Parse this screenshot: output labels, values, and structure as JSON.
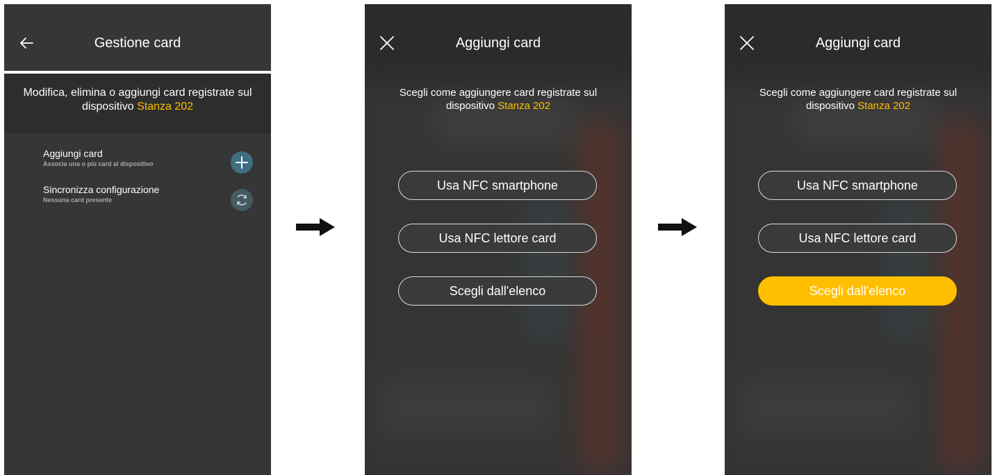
{
  "screen1": {
    "title": "Gestione card",
    "description_prefix": "Modifica, elimina o aggiungi card registrate sul dispositivo",
    "device_name": "Stanza 202",
    "items": [
      {
        "title": "Aggiungi card",
        "subtitle": "Associa una o più card al dispositivo",
        "icon": "plus-icon"
      },
      {
        "title": "Sincronizza configurazione",
        "subtitle": "Nessuna card presente",
        "icon": "sync-icon"
      }
    ]
  },
  "screen2": {
    "title": "Aggiungi card",
    "description_prefix": "Scegli come aggiungere card registrate sul dispositivo",
    "device_name": "Stanza 202",
    "options": [
      "Usa NFC smartphone",
      "Usa NFC lettore card",
      "Scegli dall'elenco"
    ]
  },
  "screen3": {
    "title": "Aggiungi card",
    "description_prefix": "Scegli come aggiungere card registrate sul dispositivo",
    "device_name": "Stanza 202",
    "options": [
      "Usa NFC smartphone",
      "Usa NFC lettore card",
      "Scegli dall'elenco"
    ],
    "selected_option": "Scegli dall'elenco"
  },
  "colors": {
    "accent": "#ffbf00",
    "background": "#363636",
    "banner": "#2d2d2d",
    "add_icon": "#3f6e82",
    "sync_icon": "#465a62"
  },
  "icons": {
    "back": "arrow-left-icon",
    "close": "close-icon",
    "flow_arrow": "right-arrow-icon"
  }
}
